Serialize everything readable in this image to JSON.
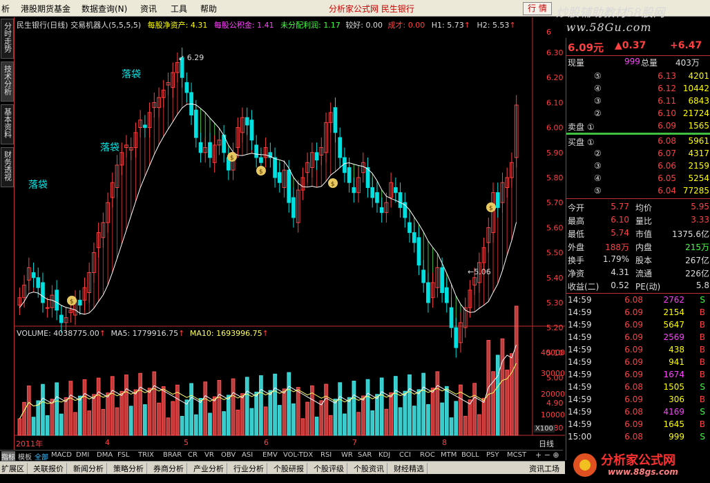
{
  "menu": {
    "items": [
      "析",
      "港股期货基金",
      "数据查询(N)",
      "资讯",
      "工具",
      "帮助"
    ],
    "center": "分析家公式网 民生银行",
    "hangq": "行 情"
  },
  "banner": {
    "line1": "炒股辅助教材58股网",
    "line2": "www.58Gu.com"
  },
  "left_tabs": [
    "分时走势",
    "技术分析",
    "基本资料",
    "财务透视"
  ],
  "chart": {
    "header": "民生银行(日线) 交易机器人(5,5,5,5)",
    "indicators": [
      {
        "label": "每股净资产:",
        "value": "4.31"
      },
      {
        "label": "每股公积金:",
        "value": "1.41"
      },
      {
        "label": "未分配利润:",
        "value": "1.17"
      },
      {
        "label": "较好:",
        "value": "0.00"
      },
      {
        "label": "成才:",
        "value": "0.00"
      },
      {
        "label": "H1:",
        "value": "5.73"
      },
      {
        "label": "H2:",
        "value": "5.53"
      }
    ],
    "price_ticks": [
      "6",
      "6.30",
      "6.20",
      "6.10",
      "6.00",
      "5.90",
      "5.80",
      "5.70",
      "5.60",
      "5.50",
      "5.40",
      "5.30",
      "5.20",
      "5.10",
      "5.00",
      "4.90",
      "4.80"
    ],
    "labels": {
      "high": "6.29",
      "low": "5.06",
      "luodai": "落袋",
      "year": "2011年",
      "months": [
        "4",
        "5",
        "6",
        "7",
        "8"
      ],
      "day": "日线"
    },
    "volume_header": {
      "vol": "VOLUME: 4038775.00",
      "ma5": "MA5: 1779916.75",
      "ma10": "MA10: 1693996.75"
    },
    "vol_ticks": [
      "40000",
      "30000",
      "20000",
      "10000"
    ],
    "vol_unit": "X100"
  },
  "chart_data": {
    "type": "candlestick",
    "title": "民生银行(日线)",
    "ylim": [
      4.75,
      6.35
    ],
    "x": [
      "2011-03",
      "2011-04",
      "2011-05",
      "2011-06",
      "2011-07",
      "2011-08"
    ],
    "high": 6.29,
    "low": 5.06,
    "last": 6.09
  },
  "quote": {
    "price": "6.09元",
    "change": "▲0.37",
    "pct": "+6.47",
    "xianliang_label": "现量",
    "xianliang": "999",
    "zongliang_label": "总量",
    "zongliang": "403万",
    "sells": [
      {
        "lv": "⑤",
        "p": "6.13",
        "v": "4201"
      },
      {
        "lv": "④",
        "p": "6.12",
        "v": "10442"
      },
      {
        "lv": "③",
        "p": "6.11",
        "v": "6843"
      },
      {
        "lv": "②",
        "p": "6.10",
        "v": "21724"
      },
      {
        "lv": "卖盘 ①",
        "p": "6.09",
        "v": "1565"
      }
    ],
    "buys": [
      {
        "lv": "买盘 ①",
        "p": "6.08",
        "v": "5961"
      },
      {
        "lv": "②",
        "p": "6.07",
        "v": "4317"
      },
      {
        "lv": "③",
        "p": "6.06",
        "v": "2159"
      },
      {
        "lv": "④",
        "p": "6.05",
        "v": "5254"
      },
      {
        "lv": "⑤",
        "p": "6.04",
        "v": "77285"
      }
    ],
    "stats": [
      [
        "今开",
        "5.77",
        "均价",
        "5.95"
      ],
      [
        "最高",
        "6.10",
        "量比",
        "3.33"
      ],
      [
        "最低",
        "5.74",
        "市值",
        "1375.6亿"
      ],
      [
        "外盘",
        "188万",
        "内盘",
        "215万"
      ],
      [
        "换手",
        "1.79%",
        "股本",
        "267亿"
      ],
      [
        "净资",
        "4.31",
        "流通",
        "226亿"
      ],
      [
        "收益(二)",
        "0.52",
        "PE(动)",
        "5.8"
      ]
    ],
    "ticks": [
      [
        "14:59",
        "6.08",
        "2762",
        "S"
      ],
      [
        "14:59",
        "6.09",
        "2154",
        "B"
      ],
      [
        "14:59",
        "6.09",
        "5647",
        "B"
      ],
      [
        "14:59",
        "6.09",
        "2569",
        "B"
      ],
      [
        "14:59",
        "6.09",
        "438",
        "B"
      ],
      [
        "14:59",
        "6.09",
        "941",
        "B"
      ],
      [
        "14:59",
        "6.09",
        "1674",
        "B"
      ],
      [
        "14:59",
        "6.08",
        "1505",
        "S"
      ],
      [
        "14:59",
        "6.09",
        "306",
        "B"
      ],
      [
        "14:59",
        "6.08",
        "4169",
        "S"
      ],
      [
        "14:59",
        "6.09",
        "1645",
        "B"
      ],
      [
        "15:00",
        "6.08",
        "999",
        "S"
      ]
    ]
  },
  "indicator_tabs": [
    "指标",
    "模板",
    "全部",
    "MACD",
    "DMI",
    "DMA",
    "FSL",
    "TRIX",
    "BRAR",
    "CR",
    "VR",
    "OBV",
    "ASI",
    "EMV",
    "VOL-TDX",
    "RSI",
    "WR",
    "SAR",
    "KDJ",
    "CCI",
    "ROC",
    "MTM",
    "BOLL",
    "PSY",
    "MCST"
  ],
  "bottom_tabs": [
    "扩展区",
    "关联报价",
    "新闻分析",
    "策略分析",
    "券商分析",
    "产业分析",
    "行业分析",
    "个股研报",
    "个股评级",
    "个股资讯",
    "财经精选"
  ],
  "bottom_right": "资讯工场",
  "logo": {
    "text": "分析家公式网",
    "url": "www.88gs.com"
  },
  "colors": {
    "up": "#ff4040",
    "down": "#00e0e0",
    "ma": "#ffff00",
    "text": "#dddddd"
  }
}
